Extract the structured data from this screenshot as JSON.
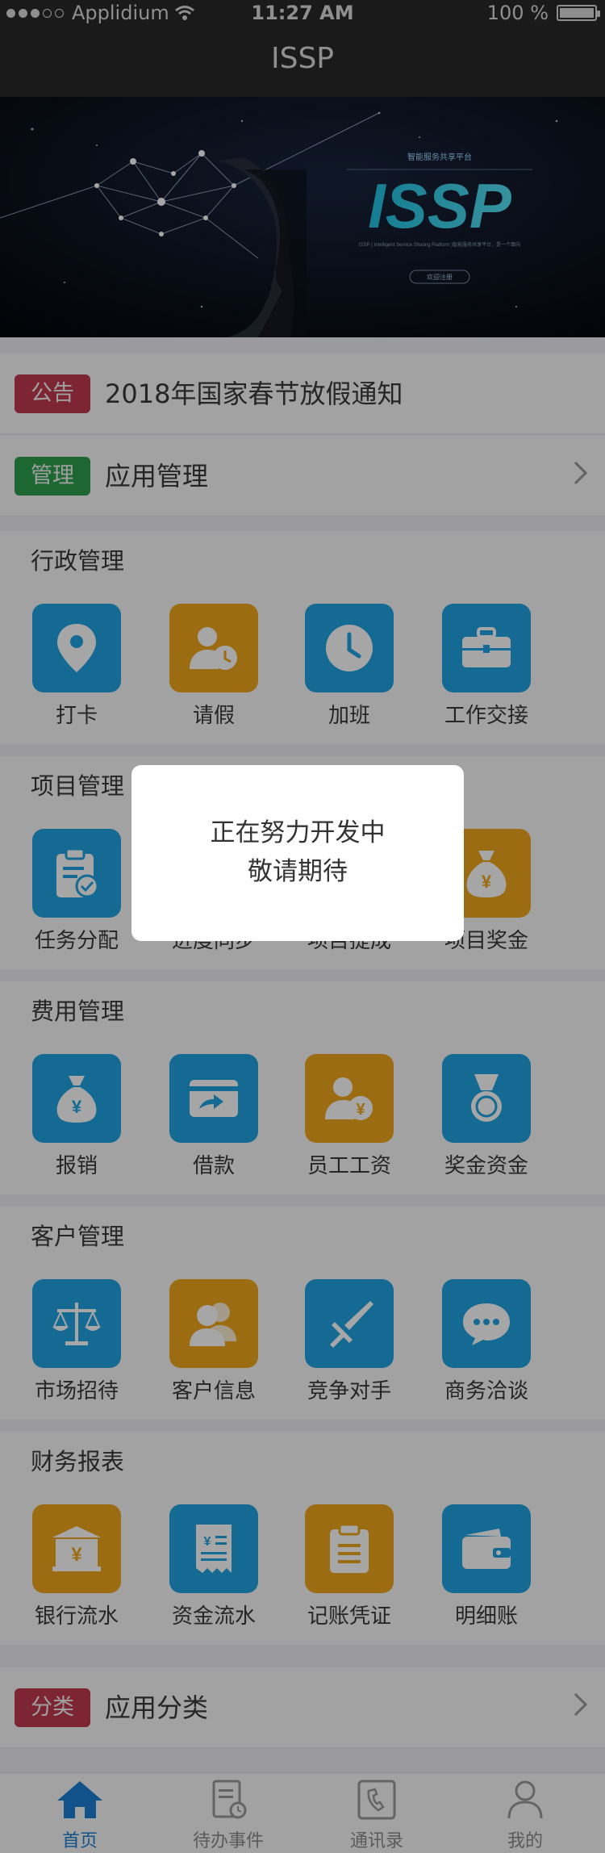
{
  "status_bar": {
    "carrier": "Applidium",
    "time": "11:27 AM",
    "battery": "100 %"
  },
  "nav": {
    "title": "ISSP"
  },
  "banner": {
    "subtitle": "智能服务共享平台",
    "logo": "ISSP",
    "description": "ISSP ( Intelligent Service Sharing Platform )智能服务共享平台，是一个面向",
    "button": "欢迎注册"
  },
  "notice": {
    "tag": "公告",
    "text": "2018年国家春节放假通知"
  },
  "manage": {
    "tag": "管理",
    "text": "应用管理"
  },
  "sections": [
    {
      "title": "行政管理",
      "items": [
        {
          "label": "打卡",
          "icon": "location-pin-icon",
          "color": "blue"
        },
        {
          "label": "请假",
          "icon": "person-clock-icon",
          "color": "orange"
        },
        {
          "label": "加班",
          "icon": "clock-icon",
          "color": "blue"
        },
        {
          "label": "工作交接",
          "icon": "briefcase-icon",
          "color": "blue"
        }
      ]
    },
    {
      "title": "项目管理",
      "items": [
        {
          "label": "任务分配",
          "icon": "clipboard-check-icon",
          "color": "blue"
        },
        {
          "label": "进度同步",
          "icon": "sync-icon",
          "color": "blue"
        },
        {
          "label": "项目提成",
          "icon": "commission-icon",
          "color": "orange"
        },
        {
          "label": "项目奖金",
          "icon": "money-bag-icon",
          "color": "orange"
        }
      ]
    },
    {
      "title": "费用管理",
      "items": [
        {
          "label": "报销",
          "icon": "money-bag-icon",
          "color": "blue"
        },
        {
          "label": "借款",
          "icon": "card-transfer-icon",
          "color": "blue"
        },
        {
          "label": "员工工资",
          "icon": "person-yuan-icon",
          "color": "orange"
        },
        {
          "label": "奖金资金",
          "icon": "medal-icon",
          "color": "blue"
        }
      ]
    },
    {
      "title": "客户管理",
      "items": [
        {
          "label": "市场招待",
          "icon": "scale-icon",
          "color": "blue"
        },
        {
          "label": "客户信息",
          "icon": "contacts-icon",
          "color": "orange"
        },
        {
          "label": "竞争对手",
          "icon": "sword-icon",
          "color": "blue"
        },
        {
          "label": "商务洽谈",
          "icon": "chat-bubble-icon",
          "color": "blue"
        }
      ]
    },
    {
      "title": "财务报表",
      "items": [
        {
          "label": "银行流水",
          "icon": "bank-yuan-icon",
          "color": "orange"
        },
        {
          "label": "资金流水",
          "icon": "receipt-icon",
          "color": "blue"
        },
        {
          "label": "记账凭证",
          "icon": "clipboard-list-icon",
          "color": "orange"
        },
        {
          "label": "明细账",
          "icon": "wallet-icon",
          "color": "blue"
        }
      ]
    }
  ],
  "category": {
    "tag": "分类",
    "text": "应用分类"
  },
  "dialog": {
    "line1": "正在努力开发中",
    "line2": "敬请期待"
  },
  "tabs": [
    {
      "label": "首页",
      "icon": "home-icon",
      "active": true
    },
    {
      "label": "待办事件",
      "icon": "todo-icon",
      "active": false
    },
    {
      "label": "通讯录",
      "icon": "phone-book-icon",
      "active": false
    },
    {
      "label": "我的",
      "icon": "person-icon",
      "active": false
    }
  ],
  "colors": {
    "blue": "#1fa4e0",
    "orange": "#f0a61c",
    "active_tab": "#1b7fd6",
    "notice_tag": "#c0394f",
    "manage_tag": "#2c9e4d"
  }
}
